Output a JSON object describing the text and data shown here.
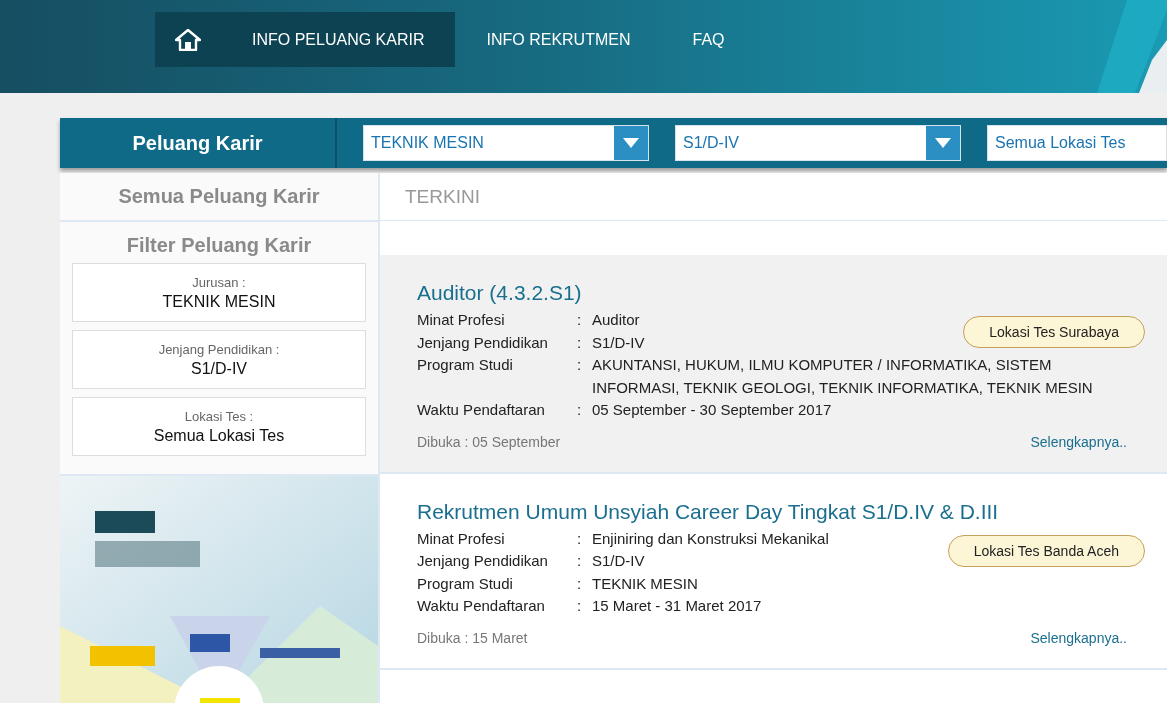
{
  "nav": [
    {
      "kind": "home",
      "selected": true
    },
    {
      "kind": "link",
      "label": "INFO PELUANG KARIR",
      "selected": true
    },
    {
      "kind": "link",
      "label": "INFO REKRUTMEN",
      "selected": false
    },
    {
      "kind": "link",
      "label": "FAQ",
      "selected": false
    }
  ],
  "filter_bar": {
    "title": "Peluang Karir",
    "selects": [
      {
        "value": "TEKNIK MESIN",
        "kind": "dropdown"
      },
      {
        "value": "S1/D-IV",
        "kind": "dropdown"
      },
      {
        "value": "Semua Lokasi Tes",
        "kind": "cut"
      }
    ]
  },
  "sidebar": {
    "all_link": "Semua Peluang Karir",
    "filter_title": "Filter Peluang Karir",
    "filters": [
      {
        "label": "Jurusan :",
        "value": "TEKNIK MESIN"
      },
      {
        "label": "Jenjang Pendidikan :",
        "value": "S1/D-IV"
      },
      {
        "label": "Lokasi Tes :",
        "value": "Semua Lokasi Tes"
      }
    ]
  },
  "section_title": "TERKINI",
  "jobs": [
    {
      "title": "Auditor (4.3.2.S1)",
      "fields": [
        {
          "label": "Minat Profesi",
          "separator": ":",
          "value": "Auditor"
        },
        {
          "label": "Jenjang Pendidikan",
          "separator": ":",
          "value": "S1/D-IV"
        },
        {
          "label": "Program Studi",
          "separator": ":",
          "value": "AKUNTANSI, HUKUM, ILMU KOMPUTER / INFORMATIKA, SISTEM INFORMASI, TEKNIK GEOLOGI, TEKNIK INFORMATIKA, TEKNIK MESIN"
        },
        {
          "label": "Waktu Pendaftaran",
          "separator": ":",
          "value": "05 September - 30 September 2017"
        }
      ],
      "location": "Lokasi Tes Surabaya",
      "opened": "Dibuka : 05 September",
      "more": "Selengkapnya..",
      "highlighted": true
    },
    {
      "title": "Rekrutmen Umum Unsyiah Career Day Tingkat S1/D.IV & D.III",
      "fields": [
        {
          "label": "Minat Profesi",
          "separator": ":",
          "value": "Enjiniring dan Konstruksi Mekanikal"
        },
        {
          "label": "Jenjang Pendidikan",
          "separator": ":",
          "value": "S1/D-IV"
        },
        {
          "label": "Program Studi",
          "separator": ":",
          "value": "TEKNIK MESIN"
        },
        {
          "label": "Waktu Pendaftaran",
          "separator": ":",
          "value": "15 Maret - 31 Maret 2017"
        }
      ],
      "location": "Lokasi Tes Banda Aceh",
      "opened": "Dibuka : 15 Maret",
      "more": "Selengkapnya..",
      "highlighted": false
    }
  ]
}
